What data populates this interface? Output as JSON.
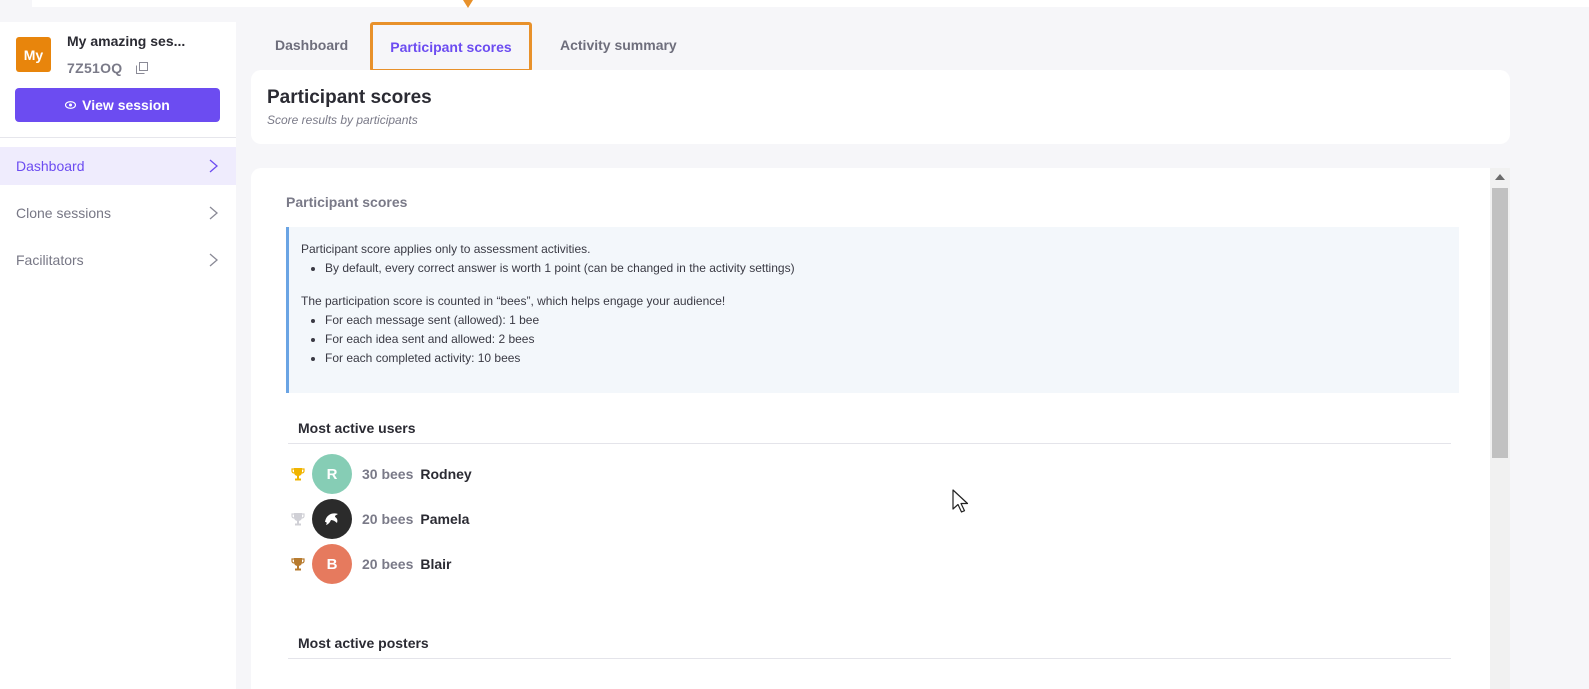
{
  "session": {
    "avatar_text": "My",
    "name": "My amazing ses...",
    "code": "7Z51OQ",
    "view_button": "View session"
  },
  "sidebar": {
    "items": [
      {
        "label": "Dashboard",
        "active": true
      },
      {
        "label": "Clone sessions",
        "active": false
      },
      {
        "label": "Facilitators",
        "active": false
      }
    ]
  },
  "tabs": [
    {
      "label": "Dashboard",
      "active": false
    },
    {
      "label": "Participant scores",
      "active": true
    },
    {
      "label": "Activity summary",
      "active": false
    }
  ],
  "header": {
    "title": "Participant scores",
    "subtitle": "Score results by participants"
  },
  "main": {
    "section_label": "Participant scores",
    "info": {
      "p1": "Participant score applies only to assessment activities.",
      "p1_items": [
        "By default, every correct answer is worth 1 point (can be changed in the activity settings)"
      ],
      "p2": "The participation score is counted in “bees”, which helps engage your audience!",
      "p2_items": [
        "For each message sent (allowed): 1 bee",
        "For each idea sent and allowed: 2 bees",
        "For each completed activity: 10 bees"
      ]
    },
    "most_active_users": {
      "title": "Most active users",
      "users": [
        {
          "initial": "R",
          "bees": "30 bees",
          "name": "Rodney",
          "avatar_color": "#86cdb5",
          "trophy_color": "#f0b400"
        },
        {
          "initial": "",
          "bees": "20 bees",
          "name": "Pamela",
          "avatar_color": "#2b2b2b",
          "trophy_color": "#d0d0d6"
        },
        {
          "initial": "B",
          "bees": "20 bees",
          "name": "Blair",
          "avatar_color": "#e67a5e",
          "trophy_color": "#b77b2f"
        }
      ]
    },
    "most_active_posters": {
      "title": "Most active posters"
    }
  },
  "colors": {
    "accent": "#6c4cf1",
    "tour_highlight": "#e8912b",
    "session_avatar": "#e8850c",
    "info_border": "#6aa4e4"
  }
}
